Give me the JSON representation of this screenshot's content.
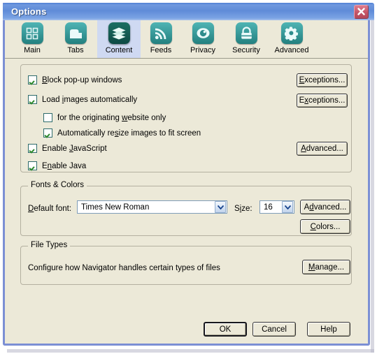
{
  "window": {
    "title": "Options",
    "close_icon": "close-icon",
    "frame_color": "#7b8fd4",
    "titlebar_color": "#5f8bd8",
    "face_color": "#ece9d8"
  },
  "tabs": {
    "selected": "Content",
    "selected_bg": "#cfd9f2",
    "icon_color": "#2d8c8c",
    "items": [
      {
        "label": "Main",
        "icon": "grid-squares-icon",
        "color": "#2d8c8c",
        "selected": false
      },
      {
        "label": "Tabs",
        "icon": "tab-page-icon",
        "color": "#2d8c8c",
        "selected": false
      },
      {
        "label": "Content",
        "icon": "stacked-pages-icon",
        "color": "#0f5a52",
        "selected": true
      },
      {
        "label": "Feeds",
        "icon": "rss-waves-icon",
        "color": "#2d8c8c",
        "selected": false
      },
      {
        "label": "Privacy",
        "icon": "eye-icon",
        "color": "#2d8c8c",
        "selected": false
      },
      {
        "label": "Security",
        "icon": "padlock-icon",
        "color": "#2d8c8c",
        "selected": false
      },
      {
        "label": "Advanced",
        "icon": "gear-icon",
        "color": "#2d8c8c",
        "selected": false
      }
    ]
  },
  "content_group": {
    "checkboxes": [
      {
        "id": "block-popups",
        "label": "Block pop-up windows",
        "accel": "B",
        "checked": true,
        "indent": false
      },
      {
        "id": "load-images",
        "label": "Load images automatically",
        "accel": "i",
        "checked": true,
        "indent": false
      },
      {
        "id": "originating",
        "label": "for the originating website only",
        "accel": "w",
        "checked": false,
        "indent": true
      },
      {
        "id": "resize-images",
        "label": "Automatically resize images to fit screen",
        "accel": "s",
        "checked": true,
        "indent": true
      },
      {
        "id": "enable-js",
        "label": "Enable JavaScript",
        "accel": "J",
        "checked": true,
        "indent": false
      },
      {
        "id": "enable-java",
        "label": "Enable Java",
        "accel": "n",
        "checked": true,
        "indent": false
      }
    ],
    "buttons": [
      {
        "id": "exceptions-popups",
        "label": "Exceptions...",
        "accel": "E"
      },
      {
        "id": "exceptions-images",
        "label": "Exceptions...",
        "accel": "x"
      },
      {
        "id": "advanced-js",
        "label": "Advanced...",
        "accel": "A"
      }
    ]
  },
  "fonts_colors": {
    "legend": "Fonts & Colors",
    "default_font_label": "Default font:",
    "default_font_accel": "D",
    "default_font_value": "Times New Roman",
    "size_label": "Size:",
    "size_accel": "i",
    "size_value": "16",
    "advanced_button": "Advanced...",
    "advanced_accel": "d",
    "colors_button": "Colors...",
    "colors_accel": "C"
  },
  "file_types": {
    "legend": "File Types",
    "description": "Configure how Navigator handles certain types of files",
    "manage_button": "Manage...",
    "manage_accel": "M"
  },
  "footer": {
    "ok": "OK",
    "cancel": "Cancel",
    "help": "Help",
    "default_button": "OK"
  }
}
